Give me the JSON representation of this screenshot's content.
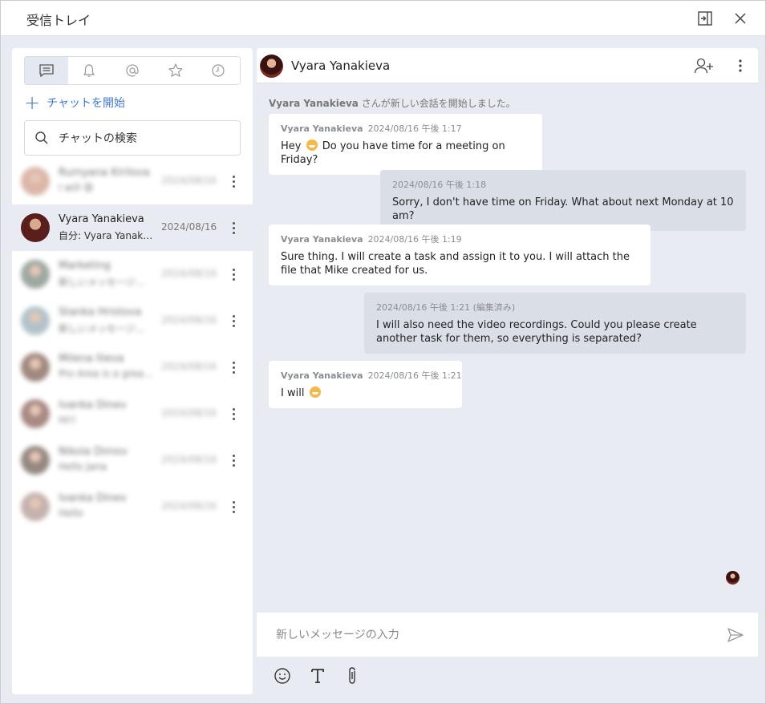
{
  "window": {
    "title": "受信トレイ"
  },
  "left_panel": {
    "tabs": [
      {
        "name": "chats-tab",
        "icon": "chat-bubble-icon",
        "active": true
      },
      {
        "name": "notifications-tab",
        "icon": "bell-icon",
        "active": false
      },
      {
        "name": "mentions-tab",
        "icon": "at-icon",
        "active": false
      },
      {
        "name": "favorites-tab",
        "icon": "star-icon",
        "active": false
      },
      {
        "name": "recent-tab",
        "icon": "clock-icon",
        "active": false
      }
    ],
    "start_chat_label": "チャットを開始",
    "search_placeholder": "チャットの検索",
    "chats": [
      {
        "name": "Rumyana Kirilova",
        "last": "I will 😄",
        "date": "2024/08/16",
        "blurred": true,
        "active": false,
        "avatar_color": "#c9907a"
      },
      {
        "name": "Vyara Yanakieva",
        "last": "自分: Vyara Yanakieva...",
        "date": "2024/08/16",
        "blurred": false,
        "active": true,
        "avatar_color": "#5a1f1c"
      },
      {
        "name": "Marketing",
        "last": "新しいメッセージを...",
        "date": "2024/08/16",
        "blurred": true,
        "active": false,
        "avatar_color": "#6b7a6f"
      },
      {
        "name": "Stanka Hristova",
        "last": "新しいメッセージ...",
        "date": "2024/08/16",
        "blurred": true,
        "active": false,
        "avatar_color": "#8aa3b0"
      },
      {
        "name": "Milena Ilieva",
        "last": "Pro Area is a great image",
        "date": "2024/08/16",
        "blurred": true,
        "active": false,
        "avatar_color": "#6e4a3c"
      },
      {
        "name": "Ivanka Dinev",
        "last": "Hi!!",
        "date": "2024/08/16",
        "blurred": true,
        "active": false,
        "avatar_color": "#7a4b44"
      },
      {
        "name": "Nikola Dimov",
        "last": "Hello Jana",
        "date": "2024/08/16",
        "blurred": true,
        "active": false,
        "avatar_color": "#5d4a3f"
      },
      {
        "name": "Ivanka Dinev",
        "last": "Hello",
        "date": "2024/08/16",
        "blurred": true,
        "active": false,
        "avatar_color": "#a58a85"
      }
    ]
  },
  "conversation": {
    "contact_name": "Vyara Yanakieva",
    "system_name": "Vyara Yanakieva",
    "system_text": " さんが新しい会話を開始しました。",
    "messages": [
      {
        "direction": "in",
        "author": "Vyara Yanakieva",
        "time": "2024/08/16 午後 1:17",
        "text_before": "Hey ",
        "emoji": true,
        "text_after": " Do you have time for a meeting on Friday?"
      },
      {
        "direction": "out",
        "author": "",
        "time": "2024/08/16 午後 1:18",
        "text_before": "Sorry, I don't have time on Friday. What about next Monday at 10 am?",
        "emoji": false,
        "text_after": ""
      },
      {
        "direction": "in",
        "author": "Vyara Yanakieva",
        "time": "2024/08/16 午後 1:19",
        "text_before": "Sure thing. I will create a task and assign it to you. I will attach the file that Mike created for us.",
        "emoji": false,
        "text_after": ""
      },
      {
        "direction": "out",
        "author": "",
        "time": "2024/08/16 午後 1:21 (編集済み)",
        "text_before": "I will also need the video recordings. Could you please create another task for them, so everything is separated?",
        "emoji": false,
        "text_after": ""
      },
      {
        "direction": "in",
        "author": "Vyara Yanakieva",
        "time": "2024/08/16 午後 1:21",
        "text_before": "I will ",
        "emoji": true,
        "text_after": ""
      }
    ],
    "composer_placeholder": "新しいメッセージの入力"
  },
  "colors": {
    "accent": "#3f78d8",
    "panel_bg": "#e8ebf1",
    "outgoing_bubble": "#dadee7"
  }
}
